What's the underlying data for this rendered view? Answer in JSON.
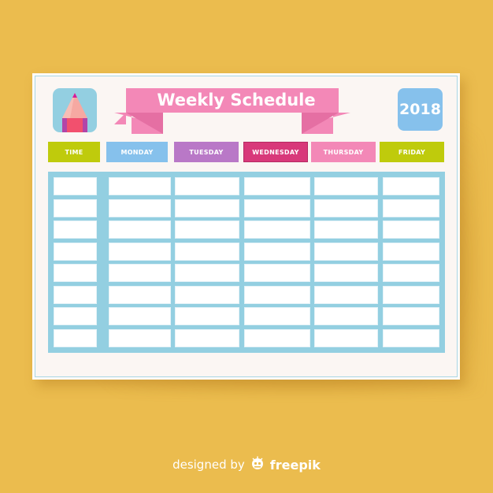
{
  "header": {
    "title": "Weekly Schedule",
    "year": "2018"
  },
  "icons": {
    "pencil": "pencil-icon",
    "freepik_logo": "freepik-logo-icon"
  },
  "columns": [
    {
      "label": "TIME",
      "color": "#BFCB0C"
    },
    {
      "label": "MONDAY",
      "color": "#86C1EC"
    },
    {
      "label": "TUESDAY",
      "color": "#B978C7"
    },
    {
      "label": "WEDNESDAY",
      "color": "#D8397A"
    },
    {
      "label": "THURSDAY",
      "color": "#F388B7"
    },
    {
      "label": "FRIDAY",
      "color": "#BFCB0C"
    }
  ],
  "table": {
    "rows": 8,
    "cells": [
      [
        "",
        "",
        "",
        "",
        "",
        ""
      ],
      [
        "",
        "",
        "",
        "",
        "",
        ""
      ],
      [
        "",
        "",
        "",
        "",
        "",
        ""
      ],
      [
        "",
        "",
        "",
        "",
        "",
        ""
      ],
      [
        "",
        "",
        "",
        "",
        "",
        ""
      ],
      [
        "",
        "",
        "",
        "",
        "",
        ""
      ],
      [
        "",
        "",
        "",
        "",
        "",
        ""
      ],
      [
        "",
        "",
        "",
        "",
        "",
        ""
      ]
    ]
  },
  "colors": {
    "background": "#EBBC4E",
    "ribbon": "#F388B7",
    "ribbon_dark": "#E56FA3",
    "grid": "#93CFE1",
    "year_box": "#86C1EC"
  },
  "footer": {
    "prefix": "designed by",
    "brand": "freepik"
  }
}
